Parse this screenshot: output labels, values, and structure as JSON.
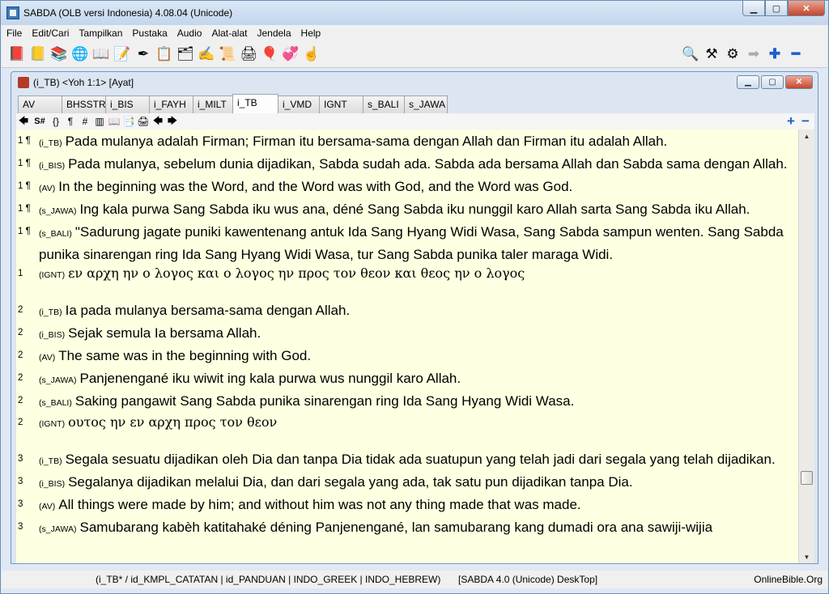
{
  "window": {
    "title": "SABDA (OLB versi Indonesia) 4.08.04  (Unicode)"
  },
  "menu": [
    "File",
    "Edit/Cari",
    "Tampilkan",
    "Pustaka",
    "Audio",
    "Alat-alat",
    "Jendela",
    "Help"
  ],
  "toolbar_icons": [
    {
      "name": "bible-red-icon",
      "glyph": "📕"
    },
    {
      "name": "books-yellow-icon",
      "glyph": "📒"
    },
    {
      "name": "books-stack-icon",
      "glyph": "📚"
    },
    {
      "name": "globe-icon",
      "glyph": "🌐"
    },
    {
      "name": "open-book-icon",
      "glyph": "📖"
    },
    {
      "name": "notes-icon",
      "glyph": "📝"
    },
    {
      "name": "pen-icon",
      "glyph": "✒"
    },
    {
      "name": "clipboard-icon",
      "glyph": "📋"
    },
    {
      "name": "lexicon-icon",
      "glyph": "🗂"
    },
    {
      "name": "write-icon",
      "glyph": "✍"
    },
    {
      "name": "scroll-icon",
      "glyph": "📜"
    },
    {
      "name": "printer-icon",
      "glyph": "🖨"
    },
    {
      "name": "balloon-icon",
      "glyph": "🎈"
    },
    {
      "name": "heart-balloons-icon",
      "glyph": "💞"
    },
    {
      "name": "hand-pointer-icon",
      "glyph": "☝"
    }
  ],
  "toolbar_right_icons": [
    {
      "name": "search-icon",
      "glyph": "🔍"
    },
    {
      "name": "tools-icon",
      "glyph": "⚒"
    },
    {
      "name": "settings-icon",
      "glyph": "⚙"
    },
    {
      "name": "arrow-right-icon",
      "glyph": "➡"
    },
    {
      "name": "zoom-in-icon",
      "glyph": "✚"
    },
    {
      "name": "zoom-out-icon",
      "glyph": "━"
    }
  ],
  "child_window": {
    "title": "(i_TB) <Yoh 1:1> [Ayat]"
  },
  "tabs": [
    "AV",
    "BHSSTR",
    "i_BIS",
    "i_FAYH",
    "i_MILT",
    "i_TB",
    "i_VMD",
    "IGNT",
    "s_BALI",
    "s_JAWA"
  ],
  "active_tab": "i_TB",
  "bible_toolbar": {
    "back": "🡄",
    "strongs": "S#",
    "braces": "{}",
    "paragraph": "¶",
    "grid": "#",
    "colors": "▥",
    "book": "📖",
    "copy": "📑",
    "print": "🖨",
    "prev": "🡄",
    "next": "🡆",
    "plus": "+",
    "minus": "−"
  },
  "verses": [
    {
      "num": "1 ¶",
      "ver": "(i_TB)",
      "text": "Pada mulanya adalah Firman; Firman itu bersama-sama dengan Allah dan Firman itu adalah Allah."
    },
    {
      "num": "1 ¶",
      "ver": "(i_BIS)",
      "text": "Pada mulanya, sebelum dunia dijadikan, Sabda sudah ada. Sabda ada bersama Allah dan Sabda sama dengan Allah."
    },
    {
      "num": "1 ¶",
      "ver": "(AV)",
      "text": "In the beginning was the Word, and the Word was with God, and the Word was God."
    },
    {
      "num": "1 ¶",
      "ver": "(s_JAWA)",
      "text": "Ing kala purwa Sang Sabda iku wus ana, déné Sang Sabda iku nunggil karo Allah sarta Sang Sabda iku Allah."
    },
    {
      "num": "1 ¶",
      "ver": "(s_BALI)",
      "text": "\"Sadurung jagate puniki kawentenang antuk Ida Sang Hyang Widi Wasa, Sang Sabda sampun wenten. Sang Sabda punika sinarengan ring Ida Sang Hyang Widi Wasa, tur Sang Sabda punika taler maraga Widi."
    },
    {
      "num": "1",
      "ver": "(IGNT)",
      "text": "εν αρχη ην ο λογος και ο λογος ην προς τον θεον και θεος ην ο λογος",
      "greek": true
    },
    {
      "gap": true
    },
    {
      "num": "2",
      "ver": "(i_TB)",
      "text": "Ia pada mulanya bersama-sama dengan Allah."
    },
    {
      "num": "2",
      "ver": "(i_BIS)",
      "text": "Sejak semula Ia bersama Allah."
    },
    {
      "num": "2",
      "ver": "(AV)",
      "text": "The same was in the beginning with God."
    },
    {
      "num": "2",
      "ver": "(s_JAWA)",
      "text": "Panjenengané iku wiwit ing kala purwa wus nunggil karo Allah."
    },
    {
      "num": "2",
      "ver": "(s_BALI)",
      "text": "Saking pangawit Sang Sabda punika sinarengan ring Ida Sang Hyang Widi Wasa."
    },
    {
      "num": "2",
      "ver": "(IGNT)",
      "text": "ουτος ην εν αρχη προς τον θεον",
      "greek": true
    },
    {
      "gap": true
    },
    {
      "num": "3",
      "ver": "(i_TB)",
      "text": "Segala sesuatu dijadikan oleh Dia dan tanpa Dia tidak ada suatupun yang telah jadi dari segala yang telah dijadikan."
    },
    {
      "num": "3",
      "ver": "(i_BIS)",
      "text": "Segalanya dijadikan melalui Dia, dan dari segala yang ada, tak satu pun dijadikan tanpa Dia."
    },
    {
      "num": "3",
      "ver": "(AV)",
      "text": "All things were made by him; and without him was not any thing made that was made."
    },
    {
      "num": "3",
      "ver": "(s_JAWA)",
      "text": "Samubarang kabèh katitahaké déning Panjenengané, lan samubarang kang dumadi ora ana sawiji-wijia"
    }
  ],
  "status": {
    "modules": "(i_TB* / id_KMPL_CATATAN | id_PANDUAN | INDO_GREEK | INDO_HEBREW)",
    "program": "[SABDA 4.0 (Unicode) DeskTop]",
    "site": "OnlineBible.Org"
  },
  "colors": {
    "content_bg": "#ffffe1",
    "titlebar": "#c2d6ec"
  }
}
